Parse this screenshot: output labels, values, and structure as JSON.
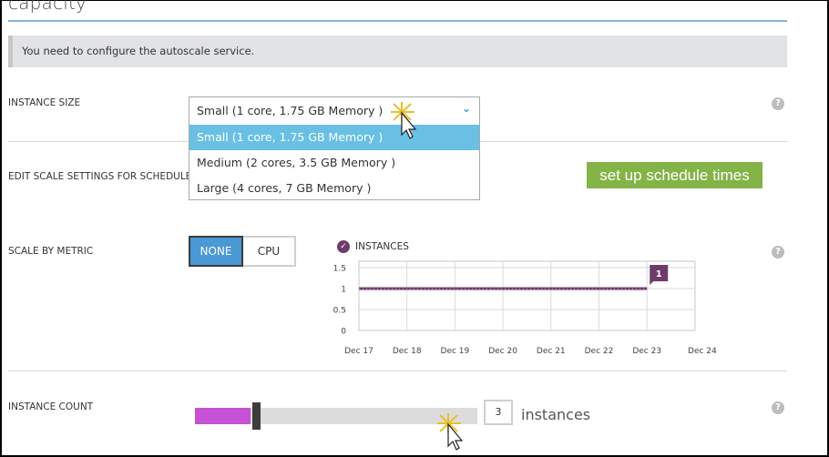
{
  "page": {
    "title": "capacity",
    "banner": "You need to configure the autoscale service."
  },
  "instance_size": {
    "label": "INSTANCE SIZE",
    "selected": "Small (1 core, 1.75 GB Memory )",
    "options": [
      "Small (1 core, 1.75 GB Memory )",
      "Medium (2 cores, 3.5 GB Memory )",
      "Large (4 cores, 7 GB Memory )"
    ],
    "highlighted_index": 0,
    "help": "?"
  },
  "schedule": {
    "label": "EDIT SCALE SETTINGS FOR SCHEDULE",
    "button": "set up schedule times"
  },
  "scale_by_metric": {
    "label": "SCALE BY METRIC",
    "options": [
      "NONE",
      "CPU"
    ],
    "selected": "NONE",
    "help": "?"
  },
  "chart_data": {
    "type": "line",
    "legend": [
      "INSTANCES"
    ],
    "series": [
      {
        "name": "INSTANCES",
        "x": [
          "Dec 17",
          "Dec 18",
          "Dec 19",
          "Dec 20",
          "Dec 21",
          "Dec 22",
          "Dec 23"
        ],
        "values": [
          1,
          1,
          1,
          1,
          1,
          1,
          1
        ]
      }
    ],
    "categories": [
      "Dec 17",
      "Dec 18",
      "Dec 19",
      "Dec 20",
      "Dec 21",
      "Dec 22",
      "Dec 23",
      "Dec 24"
    ],
    "yticks": [
      "1.5",
      "1",
      "0.5",
      "0"
    ],
    "ylim": [
      0,
      1.65
    ],
    "callout": "1",
    "grid": true,
    "color": "#6e3c6a"
  },
  "instance_count": {
    "label": "INSTANCE COUNT",
    "value": "3",
    "unit": "instances",
    "slider_fraction": 0.2,
    "help": "?"
  },
  "colors": {
    "accent_blue": "#4a98d4",
    "schedule_green": "#84b347",
    "slider_fill": "#c651d4",
    "chart_purple": "#6e3c6a",
    "dropdown_highlight": "#69c0e4"
  }
}
